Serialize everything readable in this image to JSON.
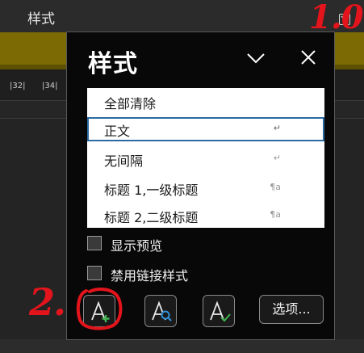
{
  "ribbon": {
    "title": "样式",
    "ruler_ticks": [
      "|32|",
      "|34|"
    ]
  },
  "pane": {
    "title": "样式",
    "styles": [
      {
        "label": "全部清除",
        "mark": ""
      },
      {
        "label": "正文",
        "mark": "↵",
        "selected": true
      },
      {
        "label": "无间隔",
        "mark": "↵"
      },
      {
        "label": "标题 1,一级标题",
        "mark": "¶a"
      },
      {
        "label": "标题 2,二级标题",
        "mark": "¶a"
      }
    ],
    "checkboxes": [
      {
        "label": "显示预览",
        "checked": false
      },
      {
        "label": "禁用链接样式",
        "checked": false
      }
    ],
    "options_label": "选项..."
  },
  "annotations": {
    "step1": "1.0",
    "step2": "2."
  },
  "colors": {
    "accent_gold": "#7c6a04",
    "selection_border": "#2b6aa3",
    "annotation_red": "#e3141c",
    "new_style_plus": "#3fb34f",
    "inspector_lens": "#2f8fd8",
    "style_check": "#3fb34f"
  }
}
